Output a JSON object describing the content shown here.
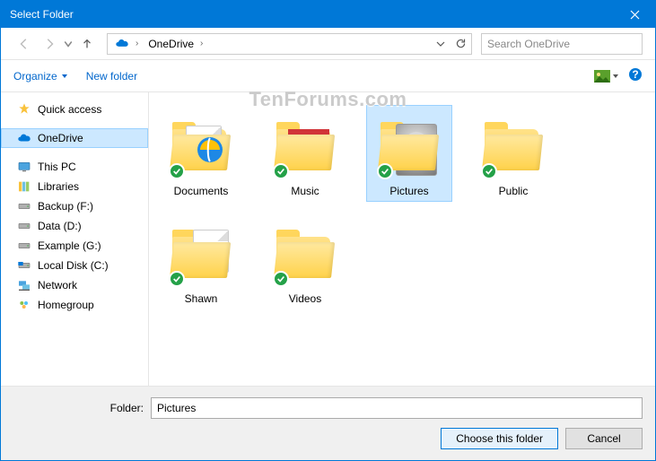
{
  "title": "Select Folder",
  "watermark": "TenForums.com",
  "breadcrumb": {
    "location": "OneDrive"
  },
  "search": {
    "placeholder": "Search OneDrive"
  },
  "toolbar": {
    "organize": "Organize",
    "newfolder": "New folder"
  },
  "sidebar": {
    "items": [
      {
        "label": "Quick access",
        "icon": "star"
      },
      {
        "label": "OneDrive",
        "icon": "onedrive",
        "selected": true
      },
      {
        "label": "This PC",
        "icon": "pc"
      },
      {
        "label": "Libraries",
        "icon": "libraries"
      },
      {
        "label": "Backup (F:)",
        "icon": "drive"
      },
      {
        "label": "Data (D:)",
        "icon": "drive"
      },
      {
        "label": "Example (G:)",
        "icon": "drive"
      },
      {
        "label": "Local Disk (C:)",
        "icon": "localdisk"
      },
      {
        "label": "Network",
        "icon": "network"
      },
      {
        "label": "Homegroup",
        "icon": "homegroup"
      }
    ]
  },
  "folders": [
    {
      "label": "Documents",
      "kind": "documents",
      "sync": true
    },
    {
      "label": "Music",
      "kind": "music",
      "sync": true
    },
    {
      "label": "Pictures",
      "kind": "pictures",
      "sync": true,
      "selected": true
    },
    {
      "label": "Public",
      "kind": "plain",
      "sync": true
    },
    {
      "label": "Shawn",
      "kind": "shawn",
      "sync": true
    },
    {
      "label": "Videos",
      "kind": "plain",
      "sync": true
    }
  ],
  "footer": {
    "folder_label": "Folder:",
    "folder_value": "Pictures",
    "choose": "Choose this folder",
    "cancel": "Cancel"
  }
}
